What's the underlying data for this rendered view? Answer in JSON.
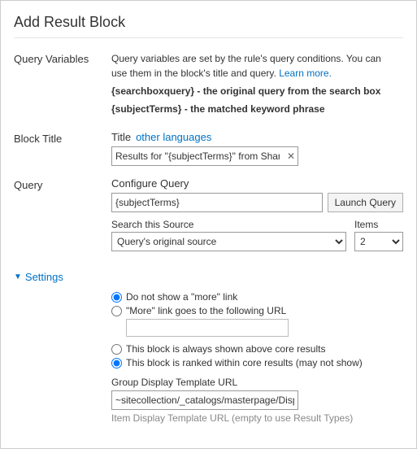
{
  "page": {
    "title": "Add Result Block"
  },
  "sections": {
    "queryVariables": {
      "label": "Query Variables",
      "info1": "Query variables are set by the rule's query conditions. You can",
      "info2": "use them in the block's title and query.",
      "learnMoreText": "Learn more.",
      "info3": "{searchboxquery} - the original query from the search box",
      "info4": "{subjectTerms} - the matched keyword phrase"
    },
    "blockTitle": {
      "label": "Block Title",
      "titleLabel": "Title",
      "otherLanguagesLink": "other languages",
      "titleInputValue": "Results for \"{subjectTerms}\" from SharePo",
      "titleInputPlaceholder": ""
    },
    "query": {
      "label": "Query",
      "configureQueryLabel": "Configure Query",
      "queryInputValue": "{subjectTerms}",
      "launchQueryBtnLabel": "Launch Query",
      "searchThisSourceLabel": "Search this Source",
      "sourceOptions": [
        "Query's original source"
      ],
      "sourceSelectedValue": "Query's original source",
      "itemsLabel": "Items",
      "itemsOptions": [
        "2"
      ],
      "itemsSelectedValue": "2"
    },
    "settings": {
      "label": "Settings",
      "radio1": {
        "id": "radio-no-more",
        "label": "Do not show a \"more\" link",
        "checked": true
      },
      "radio2": {
        "id": "radio-more-url",
        "label": "\"More\" link goes to the following URL",
        "checked": false,
        "urlInputValue": ""
      },
      "radio3": {
        "id": "radio-above-core",
        "label": "This block is always shown above core results",
        "checked": false
      },
      "radio4": {
        "id": "radio-ranked",
        "label": "This block is ranked within core results (may not show)",
        "checked": true
      },
      "groupDisplayLabel": "Group Display Template URL",
      "groupDisplayValue": "~sitecollection/_catalogs/masterpage/Displ",
      "itemDisplayLabel": "Item Display Template URL (empty to use Result Types)"
    }
  }
}
